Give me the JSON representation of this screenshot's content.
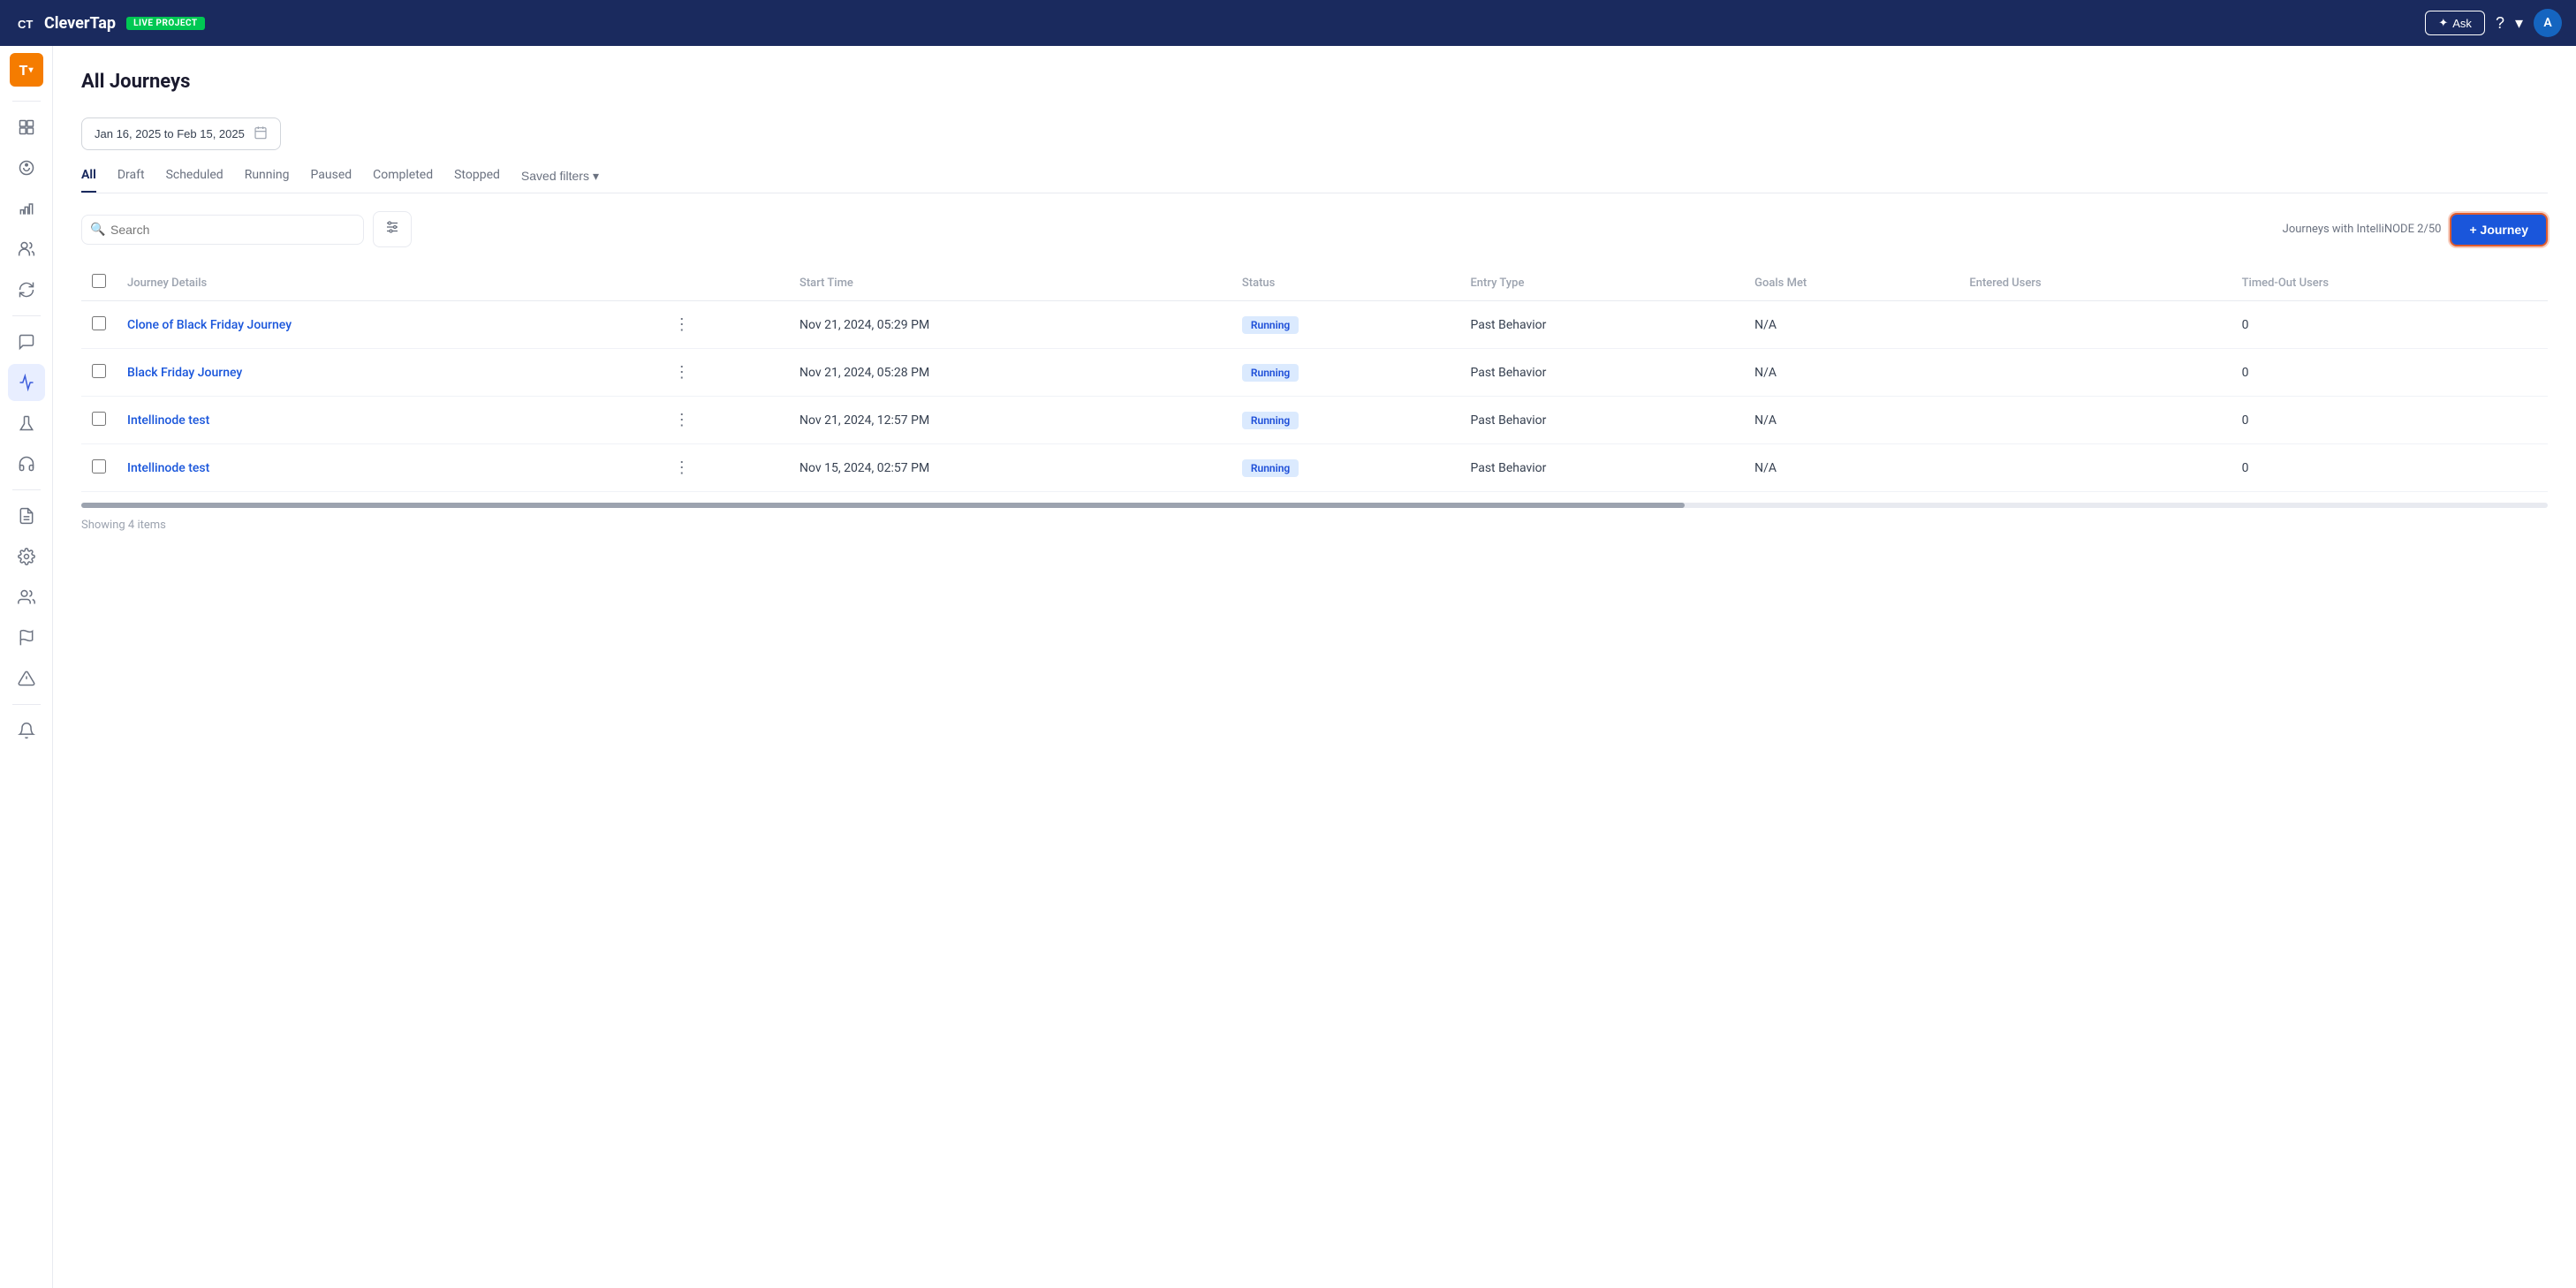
{
  "topNav": {
    "logoText": "CleverTap",
    "liveBadge": "LIVE PROJECT",
    "askLabel": "Ask",
    "helpIcon": "?",
    "avatarLabel": "A",
    "projectName": "LIVE PROJECT"
  },
  "sidebar": {
    "workspaceLabel": "T",
    "items": [
      {
        "id": "dashboard",
        "icon": "dashboard"
      },
      {
        "id": "campaigns",
        "icon": "campaigns"
      },
      {
        "id": "analytics",
        "icon": "analytics"
      },
      {
        "id": "users",
        "icon": "users"
      },
      {
        "id": "sync",
        "icon": "sync"
      },
      {
        "id": "messages",
        "icon": "messages"
      },
      {
        "id": "journeys",
        "icon": "journeys",
        "active": true
      },
      {
        "id": "experiments",
        "icon": "experiments"
      },
      {
        "id": "audio",
        "icon": "audio"
      },
      {
        "id": "reports",
        "icon": "reports"
      },
      {
        "id": "settings",
        "icon": "settings"
      },
      {
        "id": "team",
        "icon": "team"
      },
      {
        "id": "flags",
        "icon": "flags"
      },
      {
        "id": "warnings",
        "icon": "warnings"
      },
      {
        "id": "notifications",
        "icon": "notifications"
      }
    ]
  },
  "page": {
    "title": "All Journeys",
    "dateRange": "Jan 16, 2025 to Feb 15, 2025",
    "filterTabs": [
      {
        "id": "all",
        "label": "All",
        "active": true
      },
      {
        "id": "draft",
        "label": "Draft"
      },
      {
        "id": "scheduled",
        "label": "Scheduled"
      },
      {
        "id": "running",
        "label": "Running"
      },
      {
        "id": "paused",
        "label": "Paused"
      },
      {
        "id": "completed",
        "label": "Completed"
      },
      {
        "id": "stopped",
        "label": "Stopped"
      }
    ],
    "savedFiltersLabel": "Saved filters",
    "searchPlaceholder": "Search",
    "intelliInfo": "Journeys with IntelliNODE 2/50",
    "createJourneyLabel": "+ Journey",
    "showingItems": "Showing 4 items"
  },
  "table": {
    "columns": [
      {
        "id": "checkbox",
        "label": ""
      },
      {
        "id": "name",
        "label": "Journey Details"
      },
      {
        "id": "more",
        "label": ""
      },
      {
        "id": "startTime",
        "label": "Start Time"
      },
      {
        "id": "status",
        "label": "Status"
      },
      {
        "id": "entryType",
        "label": "Entry Type"
      },
      {
        "id": "goalsMet",
        "label": "Goals Met"
      },
      {
        "id": "enteredUsers",
        "label": "Entered Users"
      },
      {
        "id": "timedOutUsers",
        "label": "Timed-Out Users"
      }
    ],
    "rows": [
      {
        "id": 1,
        "name": "Clone of Black Friday Journey",
        "startTime": "Nov 21, 2024, 05:29 PM",
        "status": "Running",
        "entryType": "Past Behavior",
        "goalsMet": "N/A",
        "enteredUsers": "",
        "timedOutUsers": "0"
      },
      {
        "id": 2,
        "name": "Black Friday Journey",
        "startTime": "Nov 21, 2024, 05:28 PM",
        "status": "Running",
        "entryType": "Past Behavior",
        "goalsMet": "N/A",
        "enteredUsers": "",
        "timedOutUsers": "0"
      },
      {
        "id": 3,
        "name": "Intellinode test",
        "startTime": "Nov 21, 2024, 12:57 PM",
        "status": "Running",
        "entryType": "Past Behavior",
        "goalsMet": "N/A",
        "enteredUsers": "",
        "timedOutUsers": "0"
      },
      {
        "id": 4,
        "name": "Intellinode test",
        "startTime": "Nov 15, 2024, 02:57 PM",
        "status": "Running",
        "entryType": "Past Behavior",
        "goalsMet": "N/A",
        "enteredUsers": "",
        "timedOutUsers": "0"
      }
    ]
  }
}
